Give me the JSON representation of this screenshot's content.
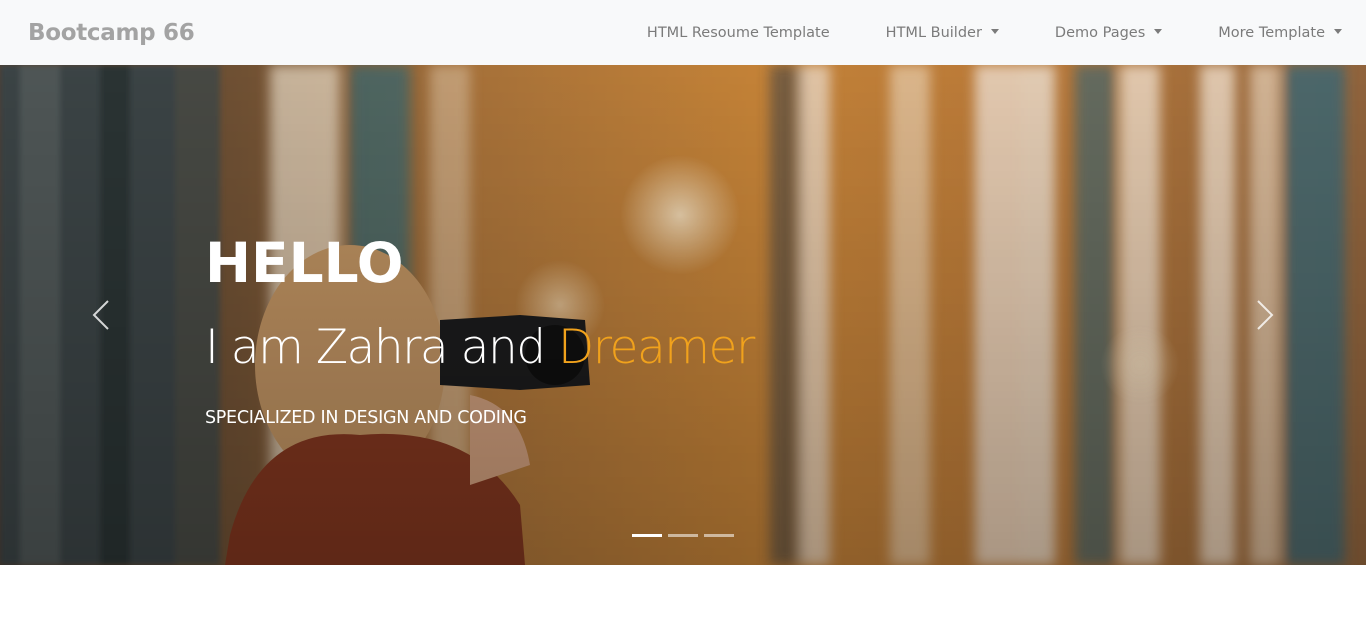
{
  "nav": {
    "brand": "Bootcamp 66",
    "items": [
      {
        "label": "HTML Resoume Template",
        "dropdown": false
      },
      {
        "label": "HTML Builder",
        "dropdown": true
      },
      {
        "label": "Demo Pages",
        "dropdown": true
      },
      {
        "label": "More Template",
        "dropdown": true
      }
    ]
  },
  "hero": {
    "hello": "HELLO",
    "intro_prefix": "I am Zahra and ",
    "intro_accent": "Dreamer",
    "subtitle": "SPECIALIZED IN DESIGN AND CODING",
    "accent_color": "#f1a21c",
    "prev_icon": "chevron-left-icon",
    "next_icon": "chevron-right-icon",
    "slides": [
      {
        "active": true
      },
      {
        "active": false
      },
      {
        "active": false
      }
    ]
  }
}
